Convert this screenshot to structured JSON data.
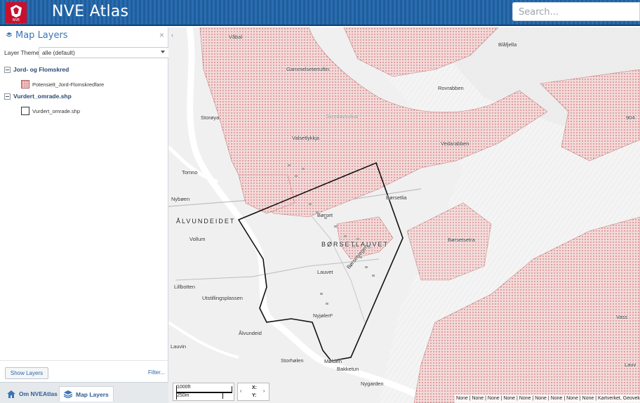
{
  "header": {
    "title": "NVE Atlas",
    "logo_text": "NVE",
    "search_placeholder": "Search..."
  },
  "sidebar": {
    "title": "Map Layers",
    "close_symbol": "×",
    "layer_theme_label": "Layer Theme:",
    "layer_theme_value": "alle (default)",
    "groups": [
      {
        "label": "Jord- og Flomskred",
        "items": [
          {
            "label": "Potensielt_Jord-Flomskredfare",
            "icon": "hatched-red-swatch"
          }
        ]
      },
      {
        "label": "Vurdert_omrade.shp",
        "items": [
          {
            "label": "Vurdert_omrade.shp",
            "icon": "outline-swatch"
          }
        ]
      }
    ],
    "show_layers_button": "Show Layers",
    "filter_link": "Filter...",
    "tabs": [
      {
        "label": "Om NVEAtlas",
        "icon": "home-icon",
        "active": false
      },
      {
        "label": "Map Layers",
        "icon": "layers-icon",
        "active": true
      }
    ]
  },
  "map": {
    "collapse_symbol": "‹",
    "labels": [
      "Våbal",
      "Gammelsetertuftin",
      "Blåfjella",
      "Rovrabben",
      "Storøya",
      "Skredavsvikar",
      "Valsetlykkja",
      "Vedarabben",
      "904",
      "Tomno",
      "Nybøen",
      "Børsetlia",
      "Børset",
      "ÅLVUNDEIDET",
      "Vollum",
      "BØRSETLAUVET",
      "Børsetsetra",
      "Lauvet",
      "Børsetvegen",
      "Lillbotten",
      "Utstillingsplassen",
      "Nyjølen",
      "Ålvundeid",
      "Lauvin",
      "Storhølen",
      "Mølden",
      "Bakketun",
      "Nygarden",
      "Vass",
      "Lauv"
    ],
    "scale_feet": "1000ft",
    "scale_meters": "250m",
    "coord_x_label": "X:",
    "coord_y_label": "Y:",
    "coord_prev": "‹",
    "coord_next": "›",
    "attribution": "None | None | None | None | None | None | None | None | None | Kartverket, Geovekst og kommuner"
  },
  "colors": {
    "header_blue": "#2a6db0",
    "hazard_fill": "#f1d8d8",
    "hazard_dot": "#c24b4b",
    "link_blue": "#2f67a6"
  }
}
